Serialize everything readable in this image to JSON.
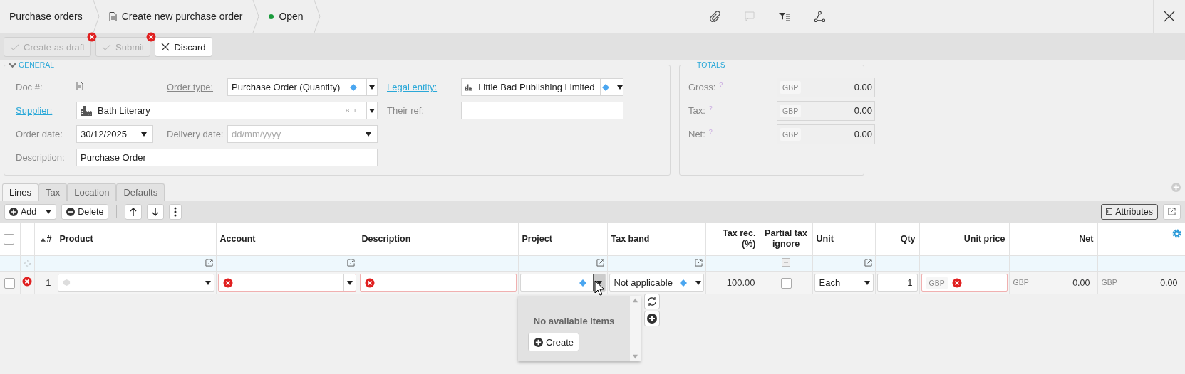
{
  "breadcrumbs": [
    {
      "label": "Purchase orders",
      "kind": "list"
    },
    {
      "label": "Create new purchase order",
      "kind": "document"
    },
    {
      "label": "Open",
      "kind": "status",
      "color": "#1a9b3c"
    }
  ],
  "actions": [
    {
      "label": "Create as draft",
      "kind": "check",
      "disabled": true,
      "error": true
    },
    {
      "label": "Submit",
      "kind": "check",
      "disabled": true,
      "error": true
    },
    {
      "label": "Discard",
      "kind": "cross",
      "disabled": false,
      "error": false
    }
  ],
  "general": {
    "title": "GENERAL",
    "expanded": true,
    "fields": [
      {
        "label": "Doc #:",
        "link": false,
        "underlined": false,
        "kind": "doc"
      },
      {
        "label": "Order type:",
        "link": false,
        "underlined": true,
        "kind": "select",
        "value": "Purchase Order (Quantity)",
        "diamond": true
      },
      {
        "label": "Legal entity:",
        "link": true,
        "underlined": true,
        "kind": "select",
        "value": "Little Bad Publishing Limited",
        "building": true,
        "diamond": true
      },
      {
        "label": "Supplier:",
        "link": true,
        "underlined": true,
        "kind": "select",
        "value": "Bath Literary",
        "building": true,
        "code": "BLIT",
        "wide": true
      },
      {
        "label": "Their ref:",
        "link": false,
        "underlined": false,
        "kind": "text"
      },
      {
        "label": "Order date:",
        "link": false,
        "underlined": false,
        "kind": "date",
        "value": "30/12/2025"
      },
      {
        "label": "Delivery date:",
        "link": false,
        "underlined": false,
        "kind": "date",
        "placeholder": "dd/mm/yyyy"
      },
      {
        "label": "Description:",
        "link": false,
        "underlined": false,
        "kind": "text",
        "value": "Purchase Order",
        "wide": true
      }
    ]
  },
  "totals": {
    "title": "TOTALS",
    "rows": [
      {
        "label": "Gross:",
        "help": "?",
        "currency": "GBP",
        "value": "0.00"
      },
      {
        "label": "Tax:",
        "help": "?",
        "currency": "GBP",
        "value": "0.00"
      },
      {
        "label": "Net:",
        "help": "?",
        "currency": "GBP",
        "value": "0.00"
      }
    ]
  },
  "tabs": [
    {
      "label": "Lines",
      "selected": true
    },
    {
      "label": "Tax",
      "selected": false
    },
    {
      "label": "Location",
      "selected": false
    },
    {
      "label": "Defaults",
      "selected": false
    }
  ],
  "lines_toolbar": {
    "add": "Add",
    "delete": "Delete",
    "attributes": "Attributes"
  },
  "table": {
    "select_all": {
      "checked": false
    },
    "columns": [
      {
        "label": "#",
        "sorted": true,
        "kind": "plain"
      },
      {
        "label": "Product",
        "sorted": false,
        "kind": "lookup"
      },
      {
        "label": "Account",
        "sorted": false,
        "kind": "lookup"
      },
      {
        "label": "Description",
        "sorted": false,
        "kind": "plain"
      },
      {
        "label": "Project",
        "sorted": false,
        "kind": "lookup"
      },
      {
        "label": "Tax band",
        "sorted": false,
        "kind": "lookup"
      },
      {
        "label": "Tax rec. (%)",
        "sorted": false,
        "kind": "plain"
      },
      {
        "label": "Partial tax ignore",
        "sorted": false,
        "kind": "checkbox"
      },
      {
        "label": "Unit",
        "sorted": false,
        "kind": "lookup"
      },
      {
        "label": "Qty",
        "sorted": false,
        "kind": "plain"
      },
      {
        "label": "Unit price",
        "sorted": false,
        "kind": "plain"
      },
      {
        "label": "Net",
        "sorted": false,
        "kind": "plain"
      }
    ],
    "rows": [
      {
        "checked": false,
        "error": true,
        "cells": [
          {
            "kind": "number",
            "value": "1"
          },
          {
            "kind": "select",
            "cube": true,
            "error": false
          },
          {
            "kind": "select",
            "error": true
          },
          {
            "kind": "input",
            "error": true
          },
          {
            "kind": "select",
            "diamond": true,
            "open": true,
            "error": false
          },
          {
            "kind": "select",
            "value": "Not applicable",
            "diamond": true,
            "error": false
          },
          {
            "kind": "number",
            "value": "100.00"
          },
          {
            "kind": "checkbox",
            "checked": false
          },
          {
            "kind": "select",
            "value": "Each",
            "error": false
          },
          {
            "kind": "number-input",
            "value": "1"
          },
          {
            "kind": "input",
            "currency": "GBP",
            "error": true
          },
          {
            "kind": "amount",
            "currency": "GBP",
            "value": "0.00"
          },
          {
            "kind": "amount",
            "currency": "GBP",
            "value": "0.00"
          }
        ]
      }
    ]
  },
  "dropdown": {
    "message": "No available items",
    "button": "Create"
  }
}
